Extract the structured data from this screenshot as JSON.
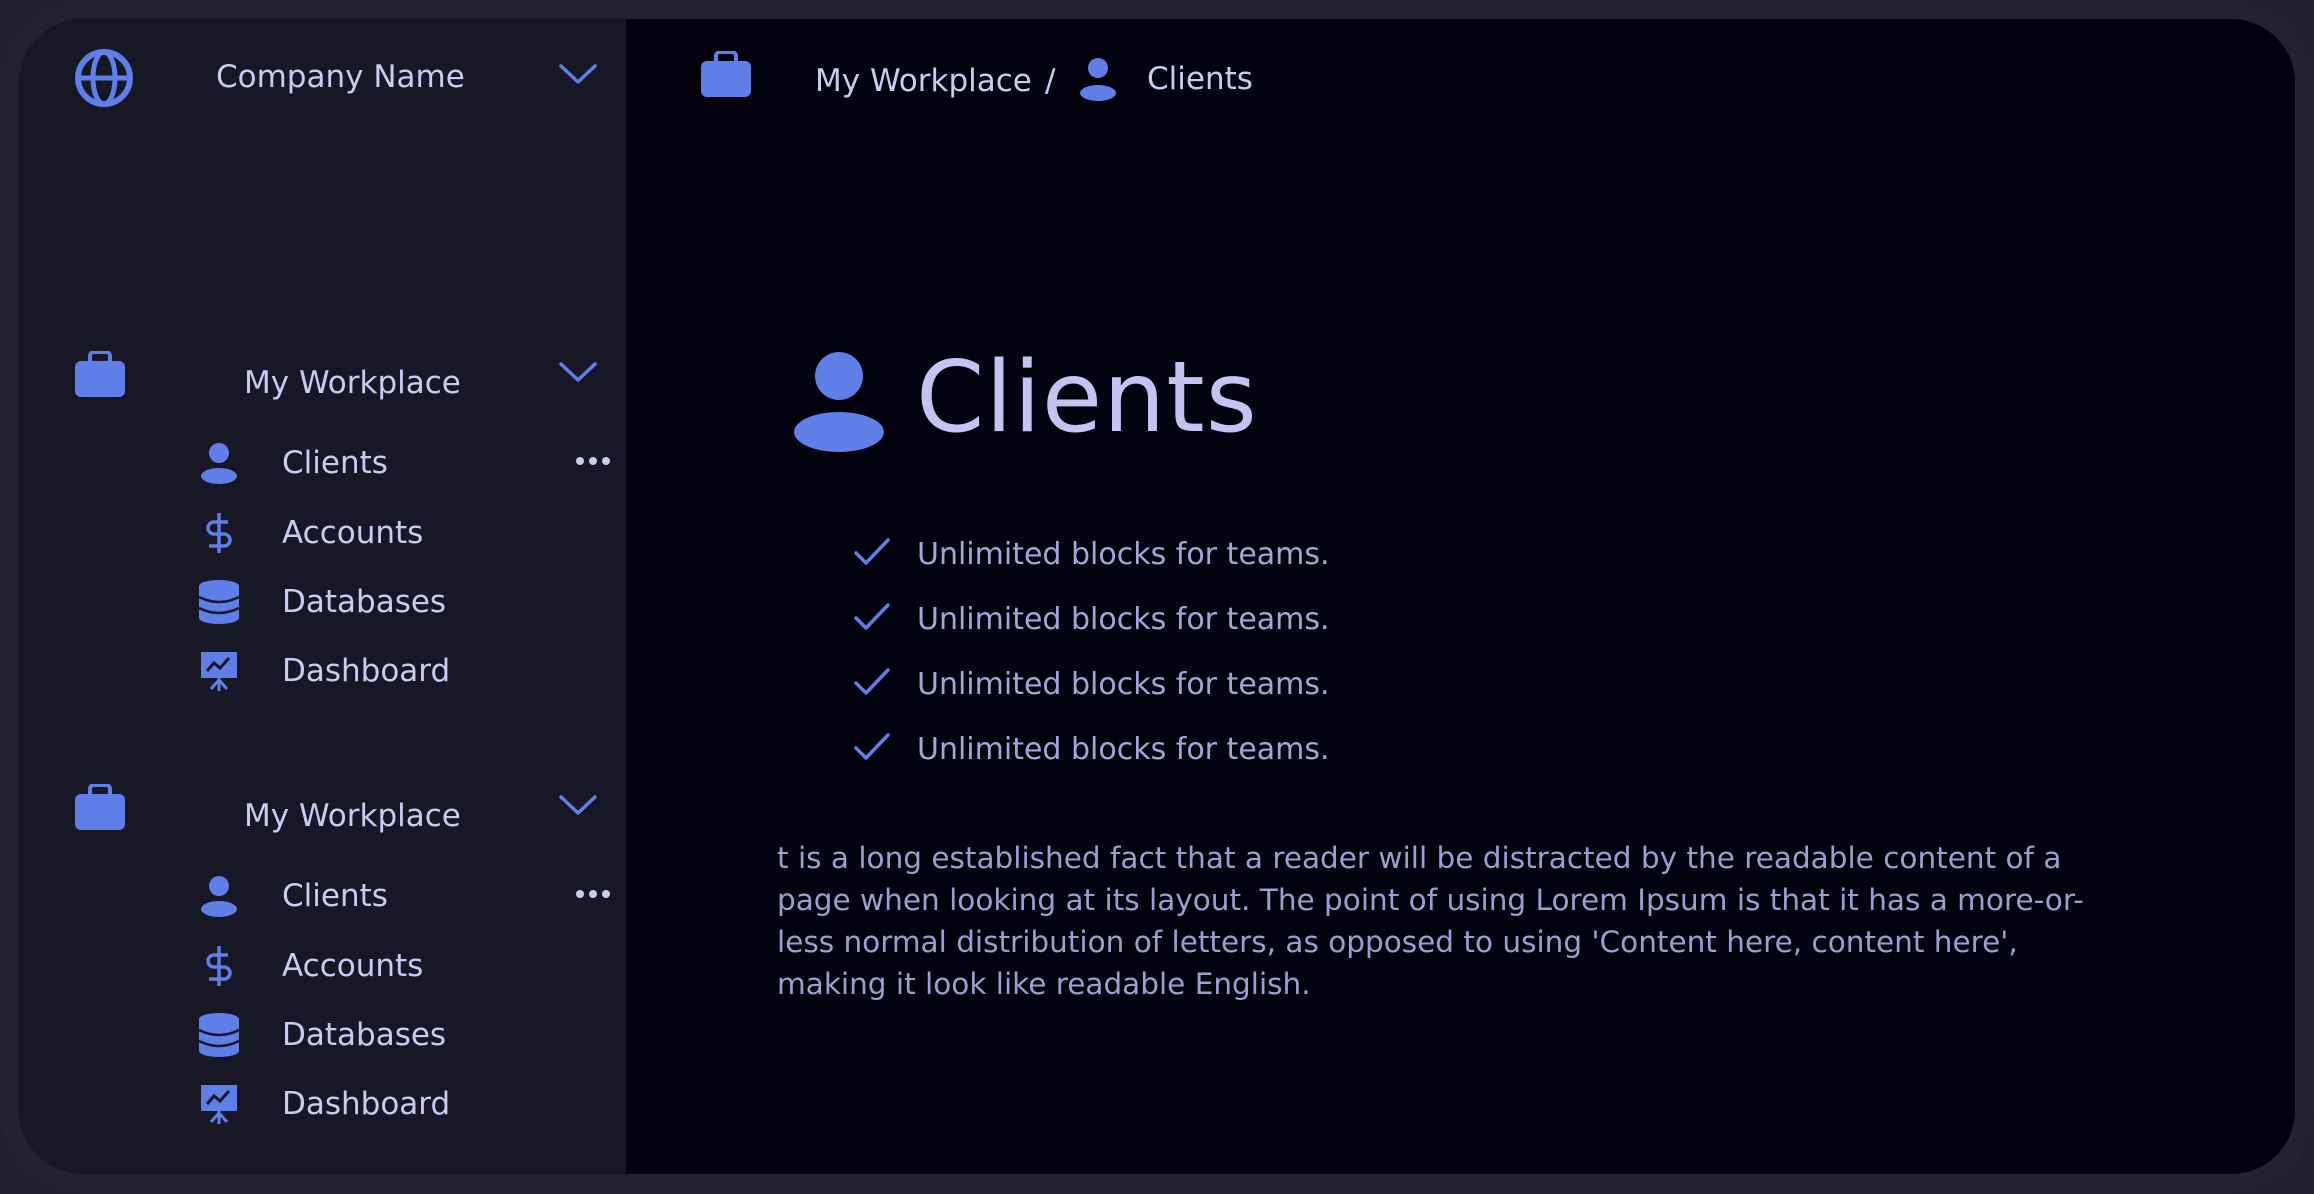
{
  "colors": {
    "accent": "#5f7fe8",
    "text": "#c9cbf0",
    "muted_text": "#a3a5d8",
    "sidebar_bg": "#171726",
    "main_bg": "#02020f",
    "frame": "#23222f"
  },
  "sidebar": {
    "company": {
      "name": "Company Name",
      "icon": "globe-icon",
      "toggle_icon": "chevron-down-icon"
    },
    "groups": [
      {
        "title": "My Workplace",
        "icon": "briefcase-icon",
        "toggle_icon": "chevron-down-icon",
        "items": [
          {
            "label": "Clients",
            "icon": "user-icon",
            "more_icon": "more-horizontal-icon"
          },
          {
            "label": "Accounts",
            "icon": "dollar-icon"
          },
          {
            "label": "Databases",
            "icon": "database-icon"
          },
          {
            "label": "Dashboard",
            "icon": "presentation-chart-icon"
          }
        ]
      },
      {
        "title": "My Workplace",
        "icon": "briefcase-icon",
        "toggle_icon": "chevron-down-icon",
        "items": [
          {
            "label": "Clients",
            "icon": "user-icon",
            "more_icon": "more-horizontal-icon"
          },
          {
            "label": "Accounts",
            "icon": "dollar-icon"
          },
          {
            "label": "Databases",
            "icon": "database-icon"
          },
          {
            "label": "Dashboard",
            "icon": "presentation-chart-icon"
          }
        ]
      }
    ]
  },
  "breadcrumb": {
    "icon": "briefcase-icon",
    "parent": "My Workplace",
    "separator": "/",
    "current_icon": "user-icon",
    "current": "Clients"
  },
  "main": {
    "title": "Clients",
    "title_icon": "user-icon",
    "features": [
      "Unlimited blocks for teams.",
      "Unlimited blocks for teams.",
      "Unlimited blocks for teams.",
      "Unlimited blocks for teams."
    ],
    "feature_icon": "check-icon",
    "body": "t is a long established fact that a reader will be distracted by the  readable content of a page when looking at its layout. The point of  using Lorem Ipsum is that it has a more-or-less normal distribution of  letters, as opposed to using 'Content here, content here', making it  look like readable English."
  }
}
